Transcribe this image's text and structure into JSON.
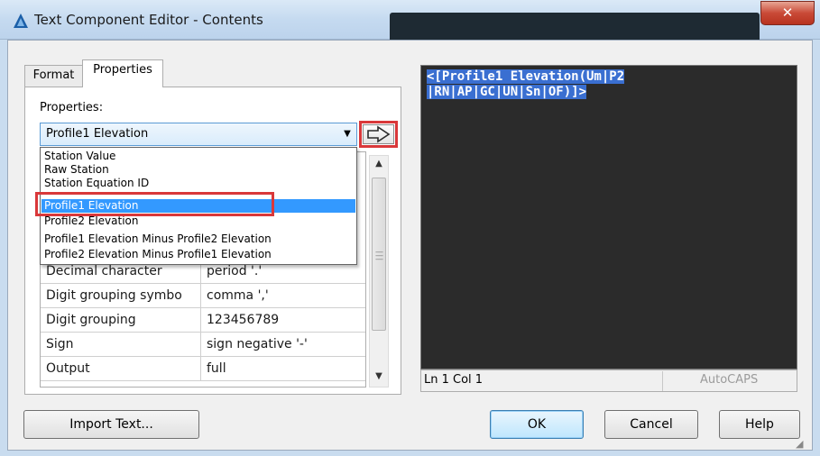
{
  "window": {
    "title": "Text Component Editor - Contents",
    "close_label": "✕"
  },
  "tabs": [
    {
      "label": "Format"
    },
    {
      "label": "Properties"
    }
  ],
  "properties_label": "Properties:",
  "property_select": {
    "value": "Profile1 Elevation"
  },
  "dropdown_options": [
    "Station Value",
    "Raw Station",
    "Station Equation ID",
    "Profile1 Elevation",
    "Profile2 Elevation",
    "Profile1 Elevation Minus Profile2 Elevation",
    "Profile2 Elevation Minus Profile1 Elevation"
  ],
  "dropdown_selected_index": 3,
  "grid_rows": [
    {
      "name": "Decimal character",
      "value": "period '.'"
    },
    {
      "name": "Digit grouping symbo",
      "value": "comma ','"
    },
    {
      "name": "Digit grouping",
      "value": "123456789"
    },
    {
      "name": "Sign",
      "value": "sign negative '-'"
    },
    {
      "name": "Output",
      "value": "full"
    }
  ],
  "editor": {
    "lines": [
      "<[Profile1 Elevation(Um|P2",
      "|RN|AP|GC|UN|Sn|OF)]>"
    ]
  },
  "status": {
    "position": "Ln 1 Col 1",
    "caps": "AutoCAPS"
  },
  "buttons": {
    "import": "Import Text...",
    "ok": "OK",
    "cancel": "Cancel",
    "help": "Help"
  },
  "icons": {
    "title": "app-icon",
    "insert": "insert-arrow-icon"
  },
  "colors": {
    "selection": "#3399ff",
    "highlight_box": "#d9383a",
    "editor_bg": "#2b2b2b"
  }
}
